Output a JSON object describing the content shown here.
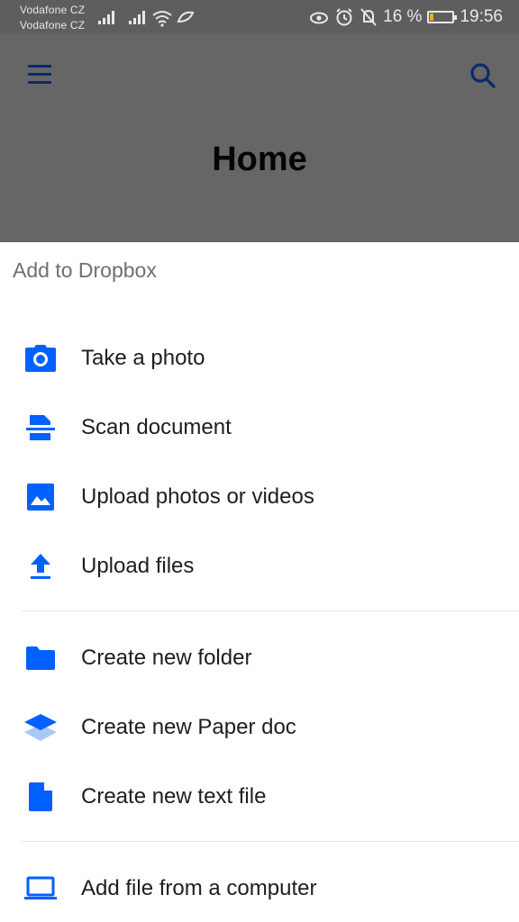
{
  "status_bar": {
    "carrier_1": "Vodafone CZ",
    "carrier_2": "Vodafone CZ",
    "battery_percent": "16 %",
    "battery_level": 0.16,
    "time": "19:56"
  },
  "header": {
    "title": "Home"
  },
  "sheet": {
    "title": "Add to Dropbox",
    "items": [
      {
        "label": "Take a photo",
        "icon": "camera-icon"
      },
      {
        "label": "Scan document",
        "icon": "scan-document-icon"
      },
      {
        "label": "Upload photos or videos",
        "icon": "image-icon"
      },
      {
        "label": "Upload files",
        "icon": "upload-icon"
      },
      {
        "label": "Create new folder",
        "icon": "folder-icon"
      },
      {
        "label": "Create new Paper doc",
        "icon": "paper-icon"
      },
      {
        "label": "Create new text file",
        "icon": "file-icon"
      },
      {
        "label": "Add file from a computer",
        "icon": "laptop-icon"
      }
    ]
  },
  "colors": {
    "accent": "#0061fe",
    "header_dimmed": "#666666",
    "status_bar": "#5e5e5e"
  }
}
